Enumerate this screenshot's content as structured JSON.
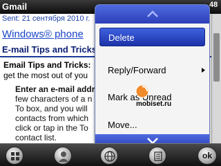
{
  "titlebar": {
    "app_title": "Gmail",
    "clock": "48"
  },
  "email": {
    "sent": "Sent: 21 сентября 2010 г.",
    "link_title": "Windows® phone",
    "subtitle": "E-mail Tips and Tricks",
    "lead_bold": "Email Tips and Tricks:",
    "lead_line2": "get the most out of you",
    "body_lines": [
      "Enter an e-mail addr",
      "few characters of a n",
      "To box, and you will",
      "contacts from which",
      "click or tap in the To",
      "contact list."
    ]
  },
  "menu": {
    "items": [
      {
        "label": "Delete",
        "selected": true,
        "submenu": false
      },
      {
        "label": "Reply/Forward",
        "selected": false,
        "submenu": true
      },
      {
        "label": "Mark as Unread",
        "selected": false,
        "submenu": false
      },
      {
        "label": "Move...",
        "selected": false,
        "submenu": false
      }
    ]
  },
  "watermark": {
    "text": "mobiset.ru"
  },
  "softkeys": {
    "ok_label": "ok",
    "icons": [
      "windows-start-icon",
      "contact-icon",
      "globe-icon",
      "list-icon"
    ]
  },
  "colors": {
    "menu_accent": "#2c3fb8",
    "link": "#1a44c8",
    "heading": "#0a1e73"
  }
}
